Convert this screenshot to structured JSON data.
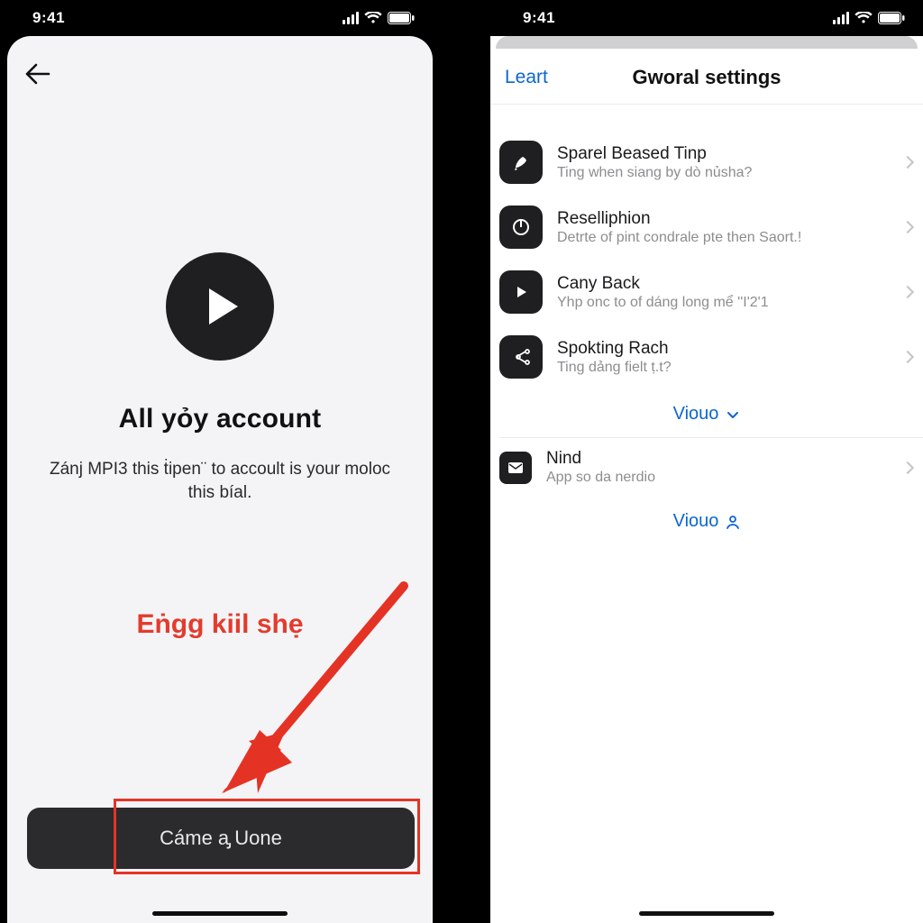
{
  "status": {
    "time": "9:41"
  },
  "left": {
    "headline": "All yỏ͏y account",
    "subline": "Zánj MPI3 this ṫipen¨ to accoult is your moloc this bíal.",
    "overlay_label": "Eṅgg kiil shẹ",
    "cta_label": "Cáme a̡ Uone"
  },
  "right": {
    "header_left": "Leart",
    "header_title": "Gworal settings",
    "rows": [
      {
        "title": "Sparel Beased Tinp",
        "subtitle": "Ting when siang by dò nủsha?"
      },
      {
        "title": "Reselliphion",
        "subtitle": "Detrte of pint condrale pte then Saort.!"
      },
      {
        "title": "Cany Back",
        "subtitle": "Yhp onc to of dáng long mể ''I'2'1"
      },
      {
        "title": "Spokting Rach",
        "subtitle": "Ting dảng fielt ṭ.t?"
      }
    ],
    "section_link_1": "Viouo",
    "row_last": {
      "title": "Nind",
      "subtitle": "App so da nerdio"
    },
    "section_link_2": "Viouo"
  }
}
